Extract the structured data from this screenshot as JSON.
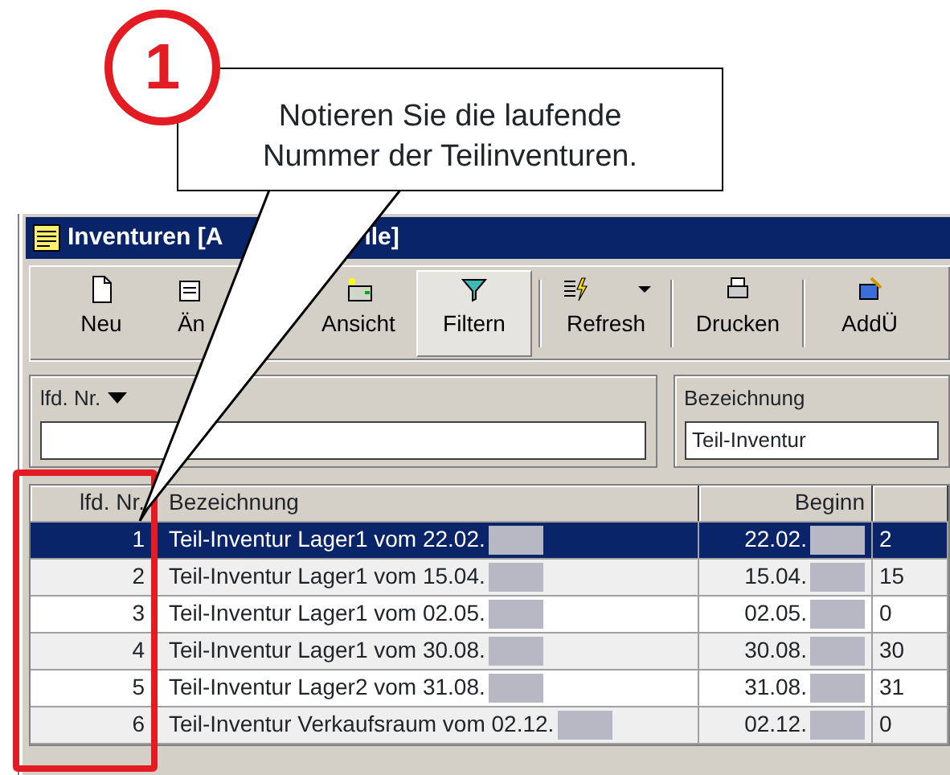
{
  "callout": {
    "number": "1",
    "text": "Notieren Sie die laufende Nummer der Teilinventuren."
  },
  "window": {
    "title_parts": [
      "Inventuren [A",
      "ile]"
    ]
  },
  "toolbar": [
    {
      "label": "Neu",
      "kind": "new",
      "pressed": false,
      "dropdown": false
    },
    {
      "label": "Än",
      "kind": "edit",
      "pressed": false,
      "dropdown": false
    },
    {
      "label": "Ansicht",
      "kind": "view",
      "pressed": false,
      "dropdown": false
    },
    {
      "label": "Filtern",
      "kind": "filter",
      "pressed": true,
      "dropdown": false
    },
    {
      "label": "Refresh",
      "kind": "refresh",
      "pressed": false,
      "dropdown": true
    },
    {
      "label": "Drucken",
      "kind": "print",
      "pressed": false,
      "dropdown": false
    },
    {
      "label": "AddÜ",
      "kind": "add",
      "pressed": false,
      "dropdown": false
    }
  ],
  "filters": [
    {
      "label": "lfd. Nr."
    },
    {
      "label": "Bezeichnung",
      "value": "Teil-Inventur"
    }
  ],
  "table": {
    "columns": [
      "lfd. Nr.",
      "Bezeichnung",
      "Beginn"
    ],
    "rows": [
      {
        "nr": "1",
        "name": "Teil-Inventur Lager1 vom 22.02.",
        "begin": "22.02.",
        "column_4": "2",
        "selected": true
      },
      {
        "nr": "2",
        "name": "Teil-Inventur Lager1 vom 15.04.",
        "begin": "15.04.",
        "column_4": "15",
        "selected": false
      },
      {
        "nr": "3",
        "name": "Teil-Inventur Lager1 vom 02.05.",
        "begin": "02.05.",
        "column_4": "0",
        "selected": false
      },
      {
        "nr": "4",
        "name": "Teil-Inventur Lager1 vom 30.08.",
        "begin": "30.08.",
        "column_4": "30",
        "selected": false
      },
      {
        "nr": "5",
        "name": "Teil-Inventur Lager2 vom 31.08.",
        "begin": "31.08.",
        "column_4": "31",
        "selected": false
      },
      {
        "nr": "6",
        "name": "Teil-Inventur Verkaufsraum vom 02.12.",
        "begin": "02.12.",
        "column_4": "0",
        "selected": false
      }
    ]
  }
}
